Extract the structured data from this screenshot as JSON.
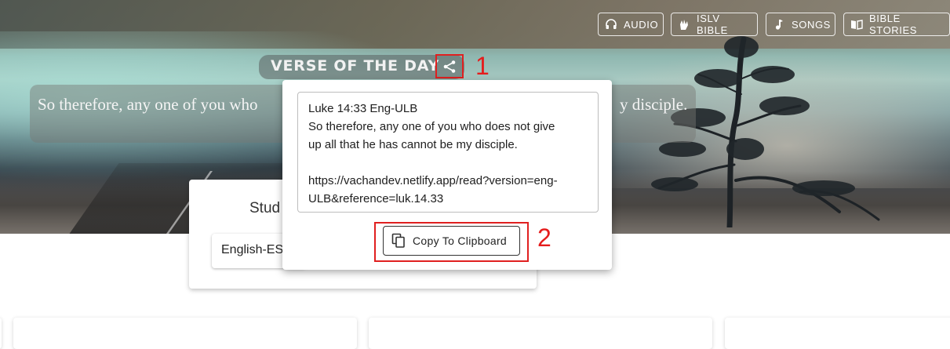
{
  "nav": {
    "audio": "AUDIO",
    "islv_bible": "ISLV BIBLE",
    "songs": "SONGS",
    "bible_stories": "BIBLE STORIES"
  },
  "votd": {
    "title": "VERSE OF THE DAY",
    "verse_left": "So therefore, any one of you who",
    "verse_right": "y disciple."
  },
  "annotations": {
    "share_marker": "1",
    "copy_marker": "2"
  },
  "study": {
    "label": "Stud",
    "select_value": "English-ES"
  },
  "share_popover": {
    "lines": [
      "Luke 14:33 Eng-ULB",
      "So therefore, any one of you who does not give",
      "up all that he has cannot be my disciple.",
      "",
      "https://vachandev.netlify.app/read?version=eng-",
      "ULB&reference=luk.14.33"
    ],
    "copy_label": "Copy To Clipboard"
  },
  "colors": {
    "annotation_red": "#e02020",
    "nav_text": "#ffffff"
  },
  "icons": {
    "audio": "headphones-icon",
    "islv_bible": "sign-language-icon",
    "songs": "music-note-icon",
    "bible_stories": "book-icon",
    "share": "share-icon",
    "copy": "copy-icon"
  }
}
